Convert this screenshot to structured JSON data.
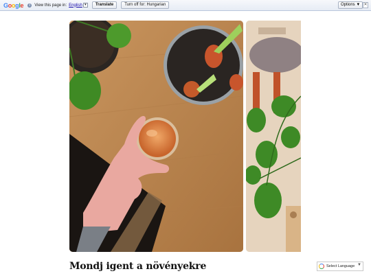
{
  "translate_bar": {
    "logo_letters": [
      "G",
      "o",
      "o",
      "g",
      "l",
      "e"
    ],
    "info_icon": "info-icon",
    "view_label": "View this page in:",
    "language": "English",
    "translate_button": "Translate",
    "turn_off_button": "Turn off for: Hungarian",
    "options_button": "Options ▼",
    "close_glyph": "✕"
  },
  "post": {
    "title": "Mondj igent a növényekre"
  },
  "language_select": {
    "label": "Select Language",
    "caret": "▼"
  },
  "colors": {
    "table_wood": "#c28e5a",
    "plant_green": "#4a8f2e",
    "pot_dark": "#2a2522",
    "drink_orange": "#e08a45"
  }
}
